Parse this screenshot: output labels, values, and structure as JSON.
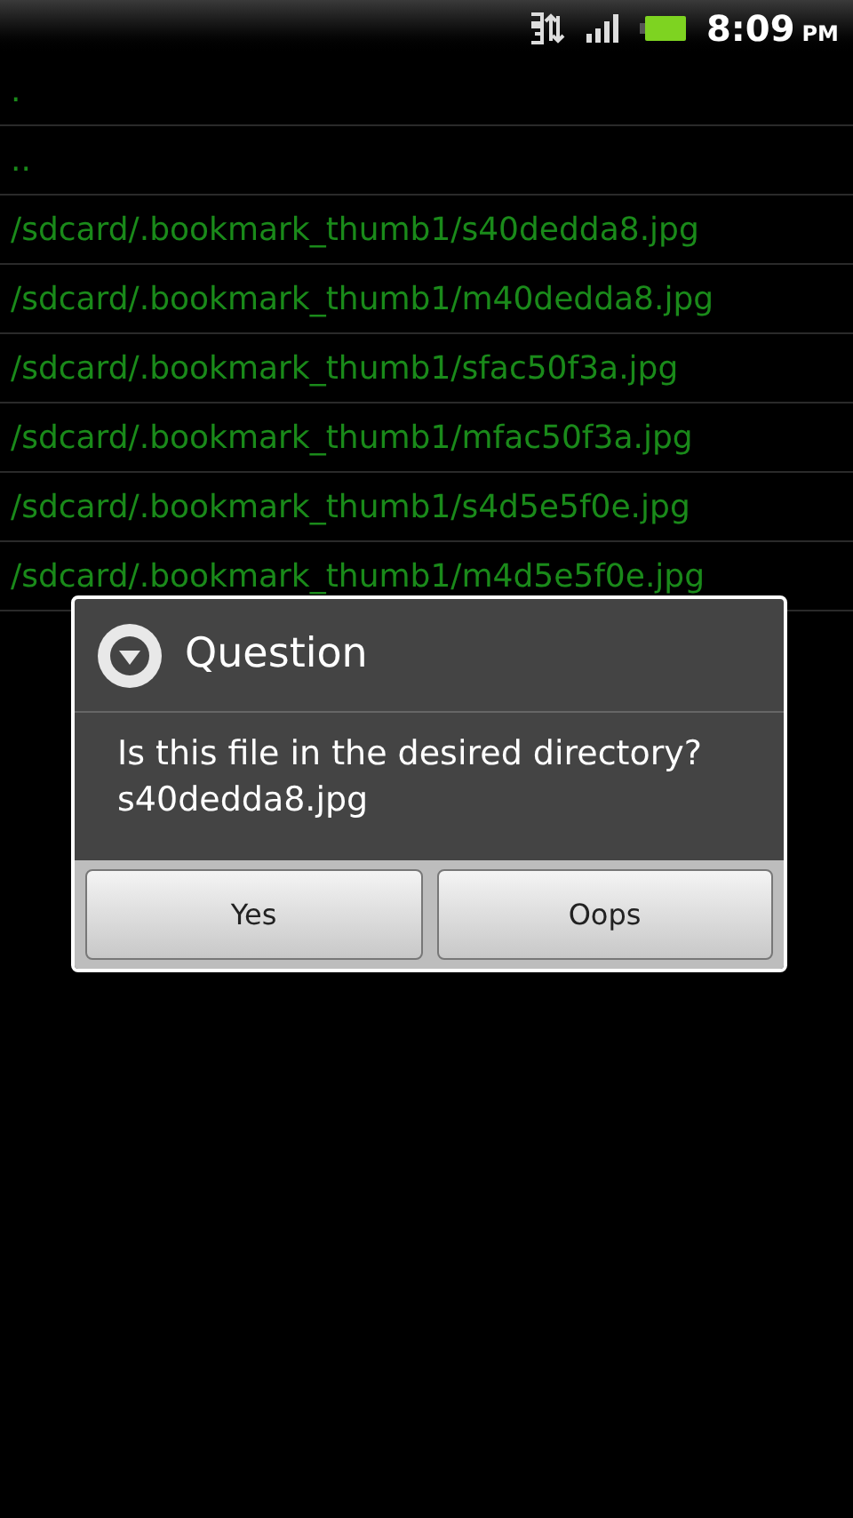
{
  "status_bar": {
    "time": "8:09",
    "am_pm": "PM"
  },
  "file_list": [
    {
      "path": "."
    },
    {
      "path": ".."
    },
    {
      "path": "/sdcard/.bookmark_thumb1/s40dedda8.jpg"
    },
    {
      "path": "/sdcard/.bookmark_thumb1/m40dedda8.jpg"
    },
    {
      "path": "/sdcard/.bookmark_thumb1/sfac50f3a.jpg"
    },
    {
      "path": "/sdcard/.bookmark_thumb1/mfac50f3a.jpg"
    },
    {
      "path": "/sdcard/.bookmark_thumb1/s4d5e5f0e.jpg"
    },
    {
      "path": "/sdcard/.bookmark_thumb1/m4d5e5f0e.jpg"
    }
  ],
  "dialog": {
    "title": "Question",
    "message": "Is this file in the desired directory?\ns40dedda8.jpg",
    "buttons": [
      "Yes",
      "Oops"
    ]
  }
}
